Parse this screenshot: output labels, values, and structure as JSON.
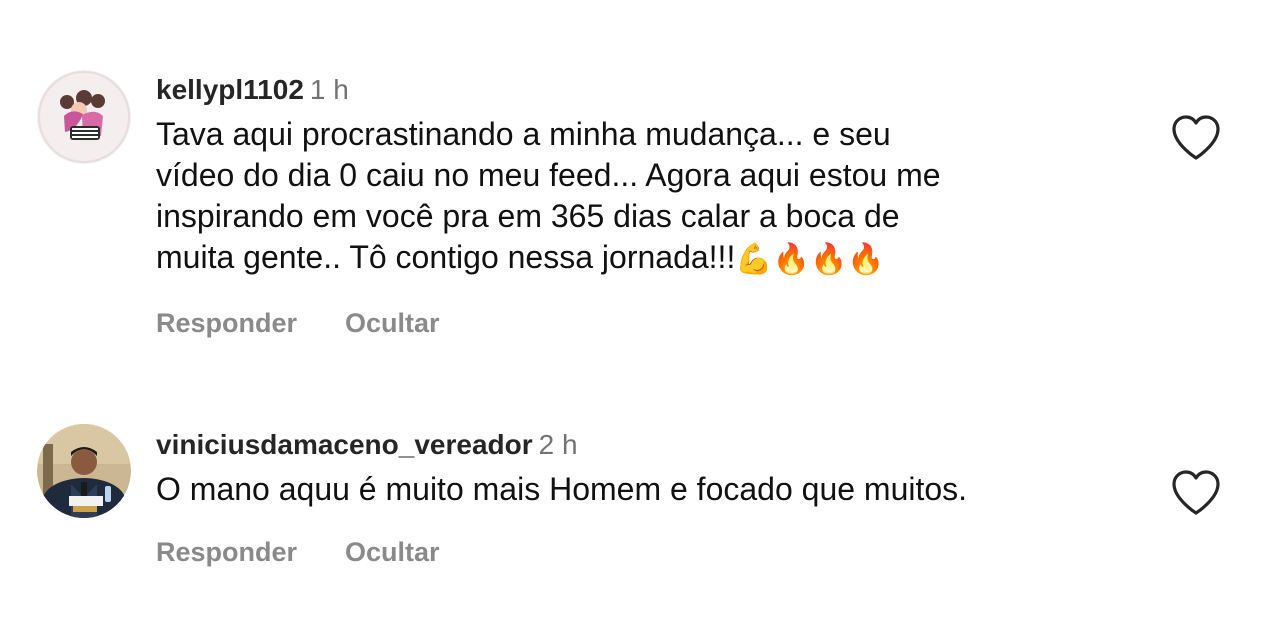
{
  "comments": [
    {
      "username": "kellypl1102",
      "time": "1 h",
      "text": "Tava aqui procrastinando a minha mudança... e seu\nvídeo do dia 0 caiu no meu feed... Agora aqui estou me\ninspirando em você pra em 365 dias calar a boca de\nmuita gente.. Tô contigo nessa jornada!!!",
      "emojis": "💪🔥🔥🔥",
      "reply_label": "Responder",
      "hide_label": "Ocultar",
      "avatar_icon": "cartoon-girl-avatar",
      "like_icon": "heart-outline-icon"
    },
    {
      "username": "viniciusdamaceno_vereador",
      "time": "2 h",
      "text": "O mano aquu é muito mais Homem e focado que muitos.",
      "reply_label": "Responder",
      "hide_label": "Ocultar",
      "avatar_icon": "man-at-desk-avatar",
      "like_icon": "heart-outline-icon"
    }
  ],
  "colors": {
    "username": "#262626",
    "meta": "#737373",
    "actions": "#8a8a8a",
    "text": "#111111"
  }
}
